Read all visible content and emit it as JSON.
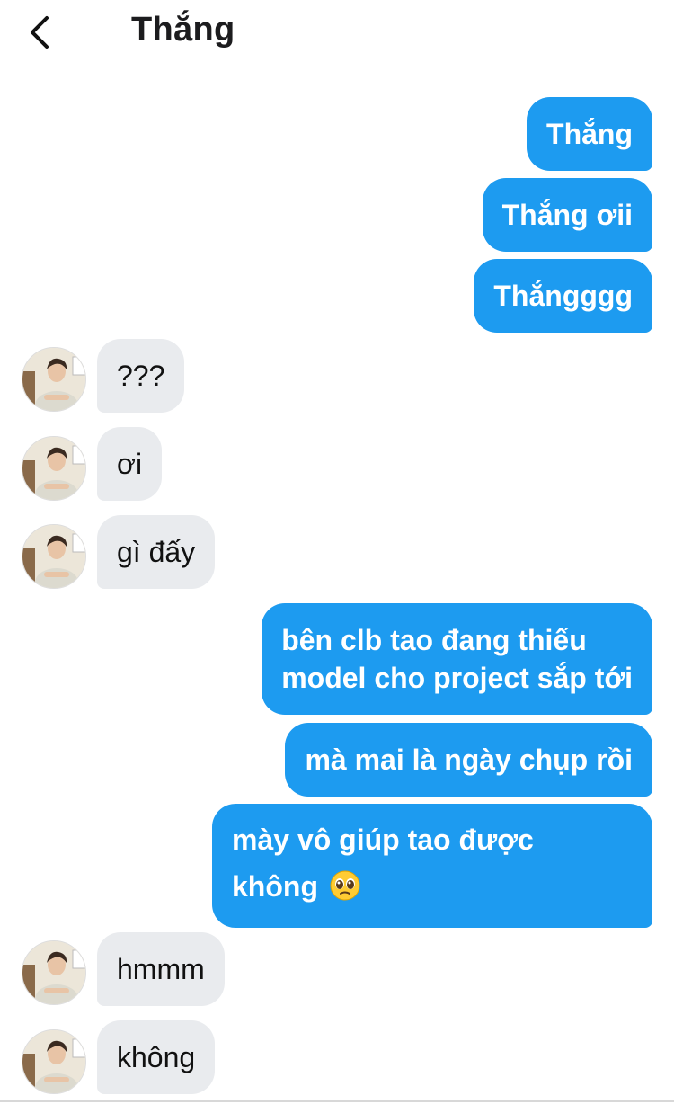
{
  "header": {
    "title": "Thắng"
  },
  "messages": [
    {
      "dir": "out",
      "text": "Thắng"
    },
    {
      "dir": "out",
      "text": "Thắng ơii"
    },
    {
      "dir": "out",
      "text": "Thắngggg"
    },
    {
      "dir": "in",
      "text": "???"
    },
    {
      "dir": "in",
      "text": "ơi"
    },
    {
      "dir": "in",
      "text": "gì đấy"
    },
    {
      "dir": "out",
      "lines": [
        "bên clb tao đang thiếu",
        "model cho project sắp tới"
      ]
    },
    {
      "dir": "out",
      "text": "mà mai là ngày chụp rồi"
    },
    {
      "dir": "out",
      "lines": [
        "mày vô giúp tao được",
        "không"
      ],
      "emoji": "pleading-face-emoji"
    },
    {
      "dir": "in",
      "text": "hmmm"
    },
    {
      "dir": "in",
      "text": "không"
    }
  ],
  "colors": {
    "outgoing": "#1d9bf0",
    "incoming": "#e9ebee",
    "background": "#ffffff"
  }
}
